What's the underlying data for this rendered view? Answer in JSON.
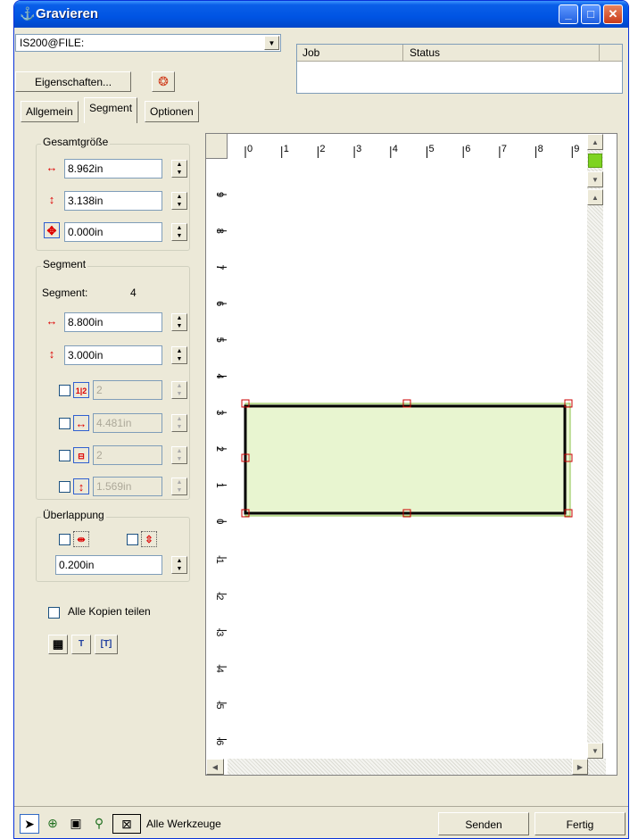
{
  "window": {
    "title": "Gravieren"
  },
  "printer": {
    "selected": "IS200@FILE:"
  },
  "buttons": {
    "properties": "Eigenschaften...",
    "send": "Senden",
    "done": "Fertig"
  },
  "job_table": {
    "columns": [
      "Job",
      "Status"
    ]
  },
  "tabs": [
    {
      "label": "Allgemein",
      "active": false
    },
    {
      "label": "Segment",
      "active": true
    },
    {
      "label": "Optionen",
      "active": false
    }
  ],
  "total_size": {
    "legend": "Gesamtgröße",
    "width": "8.962in",
    "height": "3.138in",
    "offset": "0.000in"
  },
  "segment": {
    "legend": "Segment",
    "label": "Segment:",
    "count": "4",
    "width": "8.800in",
    "height": "3.000in",
    "h_count": "2",
    "h_size": "4.481in",
    "v_count": "2",
    "v_size": "1.569in"
  },
  "overlap": {
    "legend": "Überlappung",
    "value": "0.200in"
  },
  "share_copies": {
    "label": "Alle Kopien teilen",
    "checked": false
  },
  "ruler": {
    "h_ticks": [
      "0",
      "1",
      "2",
      "3",
      "4",
      "5",
      "6",
      "7",
      "8",
      "9"
    ],
    "v_ticks": [
      "9",
      "8",
      "7",
      "6",
      "5",
      "4",
      "3",
      "2",
      "1",
      "0",
      "-1",
      "-2",
      "-3",
      "-4",
      "-5",
      "-6"
    ]
  },
  "tools": {
    "all_tools_label": "Alle Werkzeuge"
  },
  "colors": {
    "accent": "#0054e3",
    "preview_ok": "#7ed321",
    "handle": "#cc0000"
  }
}
